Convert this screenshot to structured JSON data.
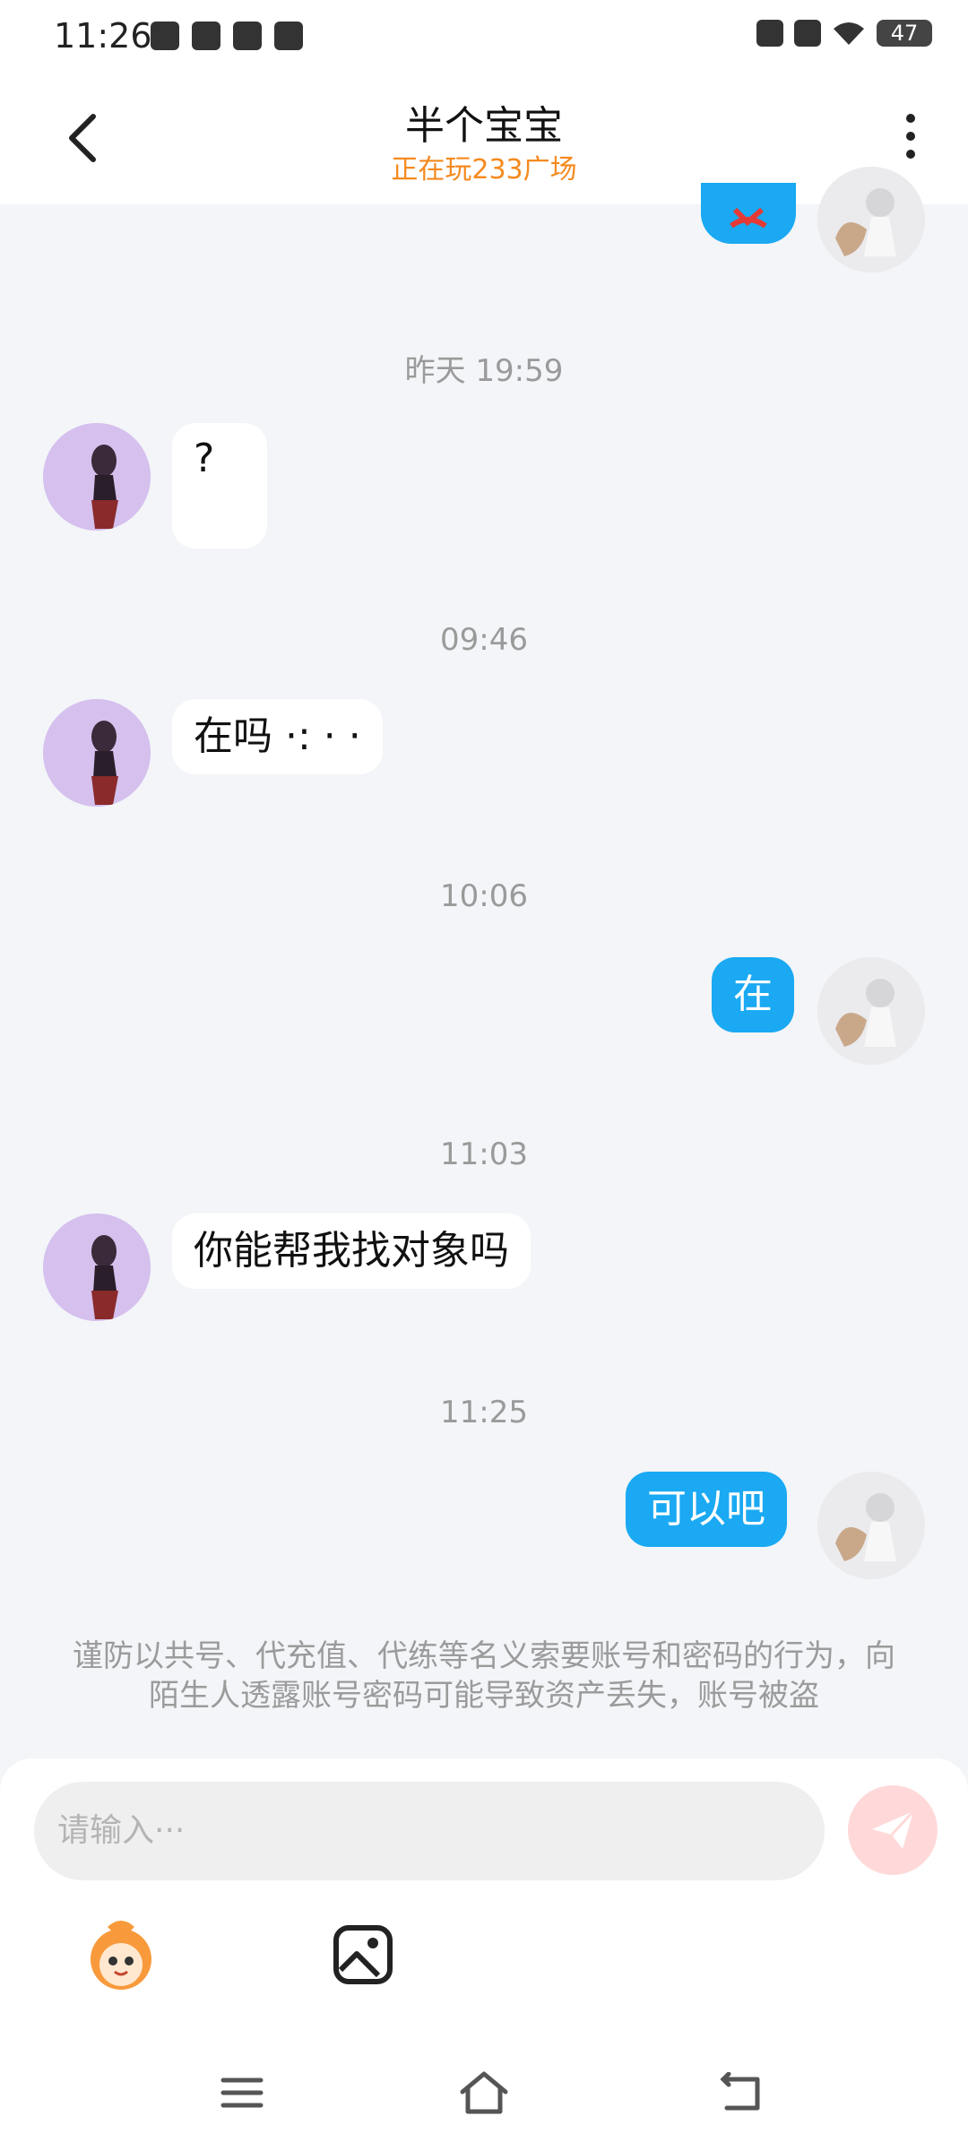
{
  "status_bar": {
    "time": "11:26",
    "battery": "47",
    "left_icons": [
      "app-notification-icon",
      "app-notification-icon",
      "app-notification-icon",
      "app-notification-icon"
    ],
    "right_icons": [
      "mute-icon",
      "blocked-icon",
      "wifi-icon",
      "battery-icon"
    ]
  },
  "header": {
    "title": "半个宝宝",
    "subtitle": "正在玩233广场",
    "subtitle_color": "#f58a1f"
  },
  "messages": [
    {
      "type": "timestamp",
      "text": "昨天 19:59"
    },
    {
      "type": "message",
      "from": "other",
      "text": "?"
    },
    {
      "type": "timestamp",
      "text": "09:46"
    },
    {
      "type": "message",
      "from": "other",
      "text": "在吗 ·: · ·"
    },
    {
      "type": "timestamp",
      "text": "10:06"
    },
    {
      "type": "message",
      "from": "self",
      "text": "在"
    },
    {
      "type": "timestamp",
      "text": "11:03"
    },
    {
      "type": "message",
      "from": "other",
      "text": "你能帮我找对象吗"
    },
    {
      "type": "timestamp",
      "text": "11:25"
    },
    {
      "type": "message",
      "from": "self",
      "text": "可以吧"
    }
  ],
  "notice": "谨防以共号、代充值、代练等名义索要账号和密码的行为，向陌生人透露账号密码可能导致资产丢失，账号被盗",
  "composer": {
    "placeholder": "请输入···",
    "tools": [
      "mascot-emoji-icon",
      "image-icon"
    ]
  },
  "nav_bar": [
    "menu-icon",
    "home-icon",
    "back-icon"
  ],
  "colors": {
    "accent_blue": "#1aa9f2",
    "background": "#f3f5f8",
    "send_button": "#ffd9d9"
  }
}
